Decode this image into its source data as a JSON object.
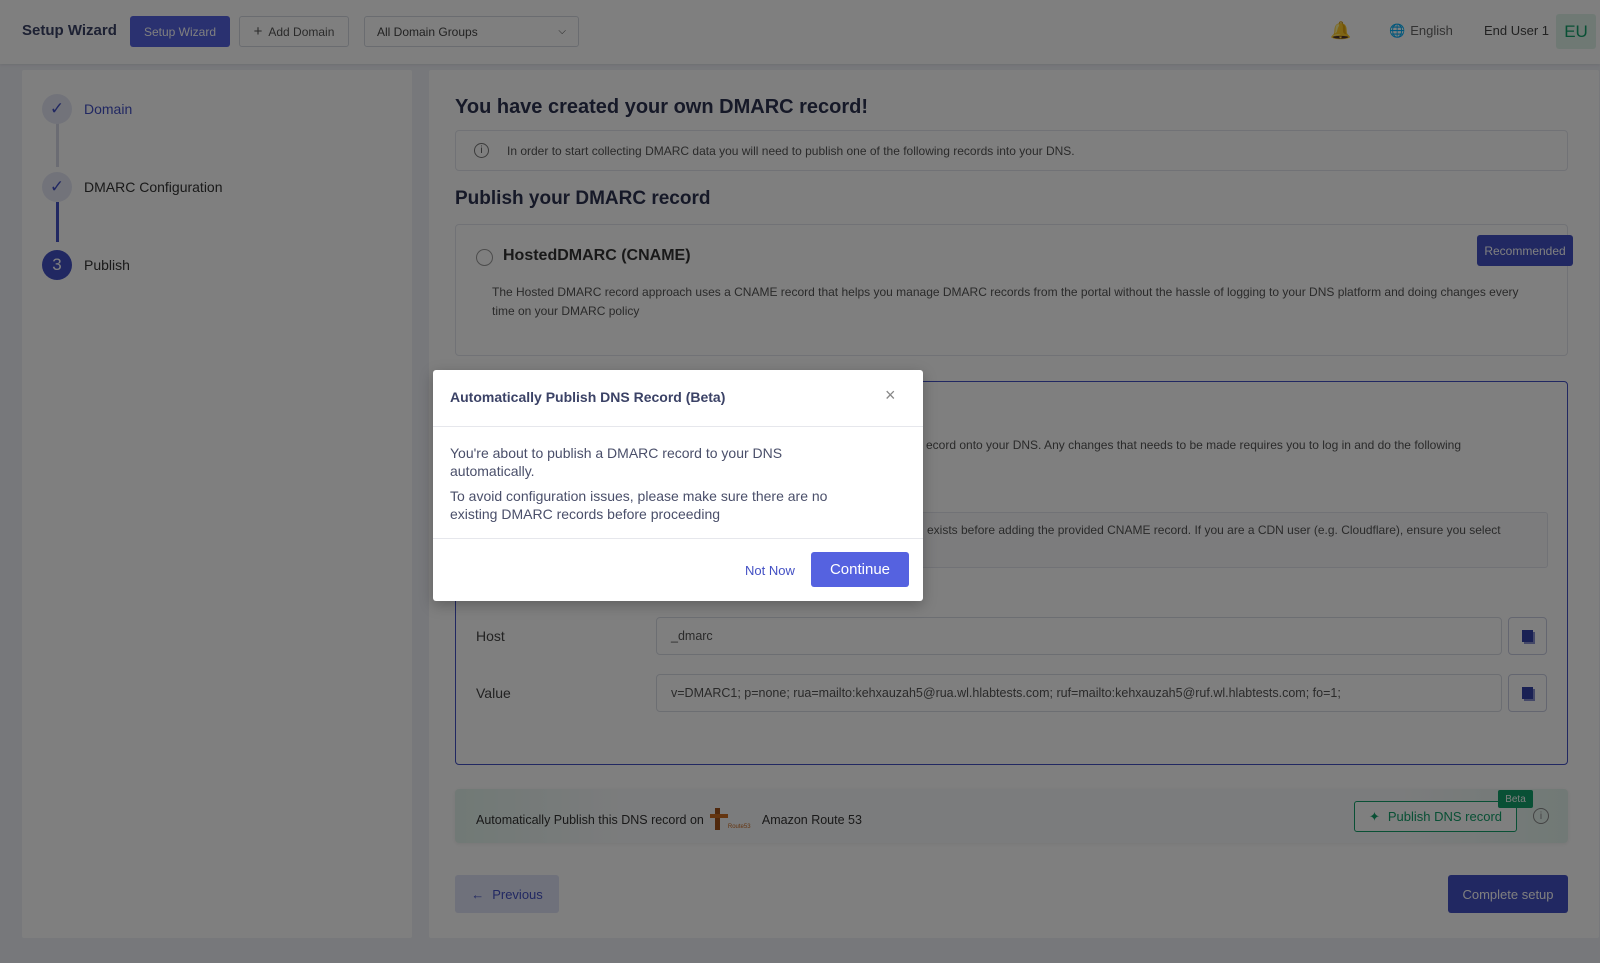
{
  "header": {
    "title": "Setup Wizard",
    "setup_wizard_button": "Setup Wizard",
    "add_domain_button": "Add Domain",
    "domain_group_select": "All Domain Groups",
    "language": "English",
    "user_name": "End User 1",
    "avatar_initials": "EU"
  },
  "steps": [
    {
      "label": "Domain",
      "state": "done"
    },
    {
      "label": "DMARC Configuration",
      "state": "done"
    },
    {
      "label": "Publish",
      "number": "3",
      "state": "current"
    }
  ],
  "main": {
    "title": "You have created your own DMARC record!",
    "info": "In order to start collecting DMARC data you will need to publish one of the following records into your DNS.",
    "publish_heading": "Publish your DMARC record",
    "hosted": {
      "title": "HostedDMARC (CNAME)",
      "badge": "Recommended",
      "description": "The Hosted DMARC record approach uses a CNAME record that helps you manage DMARC records from the portal without the hassle of logging to your DNS platform and doing changes every time on your DMARC policy"
    },
    "manual": {
      "description_visible": "ecord onto your DNS. Any changes that needs to be made requires you to log in and do the following",
      "warning_visible": "exists before adding the provided CNAME record. If you are a CDN user (e.g. Cloudflare), ensure you select",
      "host_label": "Host",
      "host_value": "_dmarc",
      "value_label": "Value",
      "value_value": "v=DMARC1; p=none; rua=mailto:kehxauzah5@rua.wl.hlabtests.com; ruf=mailto:kehxauzah5@ruf.wl.hlabtests.com; fo=1;"
    },
    "auto_publish": {
      "text": "Automatically Publish this DNS record on",
      "provider_logo_text": "Route53",
      "provider": "Amazon Route 53",
      "button": "Publish DNS record",
      "beta": "Beta"
    },
    "previous_button": "Previous",
    "complete_button": "Complete setup"
  },
  "modal": {
    "title": "Automatically Publish DNS Record (Beta)",
    "close": "×",
    "body1": "You're about to publish a DMARC record to your DNS automatically.",
    "body2": "To avoid configuration issues, please make sure there are no existing DMARC records before proceeding",
    "not_now": "Not Now",
    "continue": "Continue"
  },
  "colors": {
    "primary": "#5562e0",
    "success": "#12a06a",
    "overlay": "rgba(0,0,0,0.5)"
  }
}
